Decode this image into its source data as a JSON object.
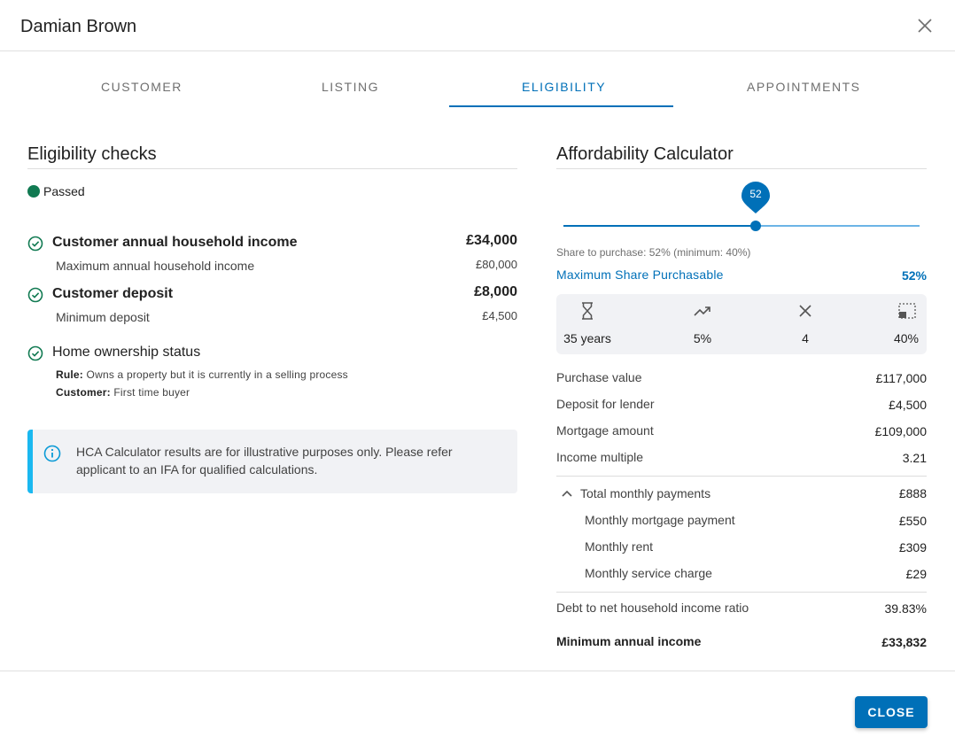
{
  "dialog": {
    "title": "Damian Brown"
  },
  "tabs": [
    {
      "label": "CUSTOMER"
    },
    {
      "label": "LISTING"
    },
    {
      "label": "ELIGIBILITY"
    },
    {
      "label": "APPOINTMENTS"
    }
  ],
  "active_tab": "ELIGIBILITY",
  "eligibility": {
    "title": "Eligibility checks",
    "status": "Passed",
    "status_color": "#117a52",
    "checks": [
      {
        "label": "Customer annual household income",
        "value": "£34,000",
        "sub_label": "Maximum annual household income",
        "sub_value": "£80,000"
      },
      {
        "label": "Customer deposit",
        "value": "£8,000",
        "sub_label": "Minimum deposit",
        "sub_value": "£4,500"
      },
      {
        "label": "Home ownership status",
        "rule_label": "Rule:",
        "rule_text": "Owns a property but it is currently in a selling process",
        "customer_label": "Customer:",
        "customer_text": "First time buyer"
      }
    ],
    "info": "HCA Calculator results are for illustrative purposes only. Please refer applicant to an IFA for qualified calculations."
  },
  "calculator": {
    "title": "Affordability Calculator",
    "slider": {
      "value": "52",
      "level_percent": 52,
      "minimum_percent": 40
    },
    "share_note": "Share to purchase: 52% (minimum: 40%)",
    "max_share_label": "Maximum Share Purchasable",
    "max_share_value": "52%",
    "stats": [
      {
        "icon": "hourglass-icon",
        "value": "35 years"
      },
      {
        "icon": "trending-up-icon",
        "value": "5%"
      },
      {
        "icon": "multiply-icon",
        "value": "4"
      },
      {
        "icon": "share-box-icon",
        "value": "40%"
      }
    ],
    "rows": [
      {
        "label": "Purchase value",
        "value": "£117,000"
      },
      {
        "label": "Deposit for lender",
        "value": "£4,500"
      },
      {
        "label": "Mortgage amount",
        "value": "£109,000"
      },
      {
        "label": "Income multiple",
        "value": "3.21"
      }
    ],
    "monthly": {
      "label": "Total monthly payments",
      "value": "£888",
      "items": [
        {
          "label": "Monthly mortgage payment",
          "value": "£550"
        },
        {
          "label": "Monthly rent",
          "value": "£309"
        },
        {
          "label": "Monthly service charge",
          "value": "£29"
        }
      ]
    },
    "debt_ratio": {
      "label": "Debt to net household income ratio",
      "value": "39.83%"
    },
    "min_income": {
      "label": "Minimum annual income",
      "value": "£33,832"
    }
  },
  "footer": {
    "close_label": "CLOSE"
  },
  "colors": {
    "accent": "#0070b8",
    "info_border": "#1ab8f0",
    "success": "#117a52"
  }
}
